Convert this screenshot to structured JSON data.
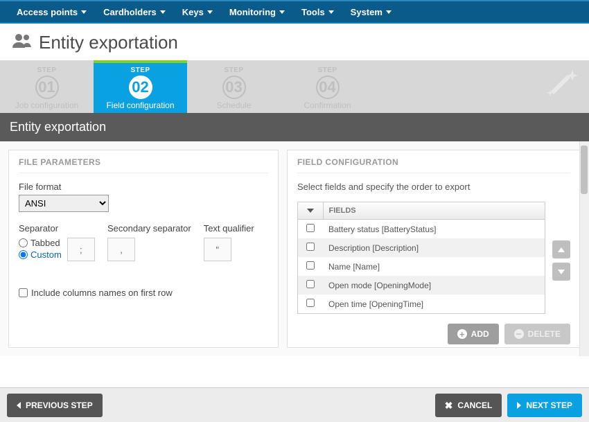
{
  "nav": {
    "items": [
      "Access points",
      "Cardholders",
      "Keys",
      "Monitoring",
      "Tools",
      "System"
    ]
  },
  "page": {
    "title": "Entity exportation"
  },
  "wizard": {
    "step_label": "STEP",
    "steps": [
      {
        "num": "01",
        "name": "Job configuration",
        "active": false
      },
      {
        "num": "02",
        "name": "Field configuration",
        "active": true
      },
      {
        "num": "03",
        "name": "Schedule",
        "active": false
      },
      {
        "num": "04",
        "name": "Confirmation",
        "active": false
      }
    ]
  },
  "section_header": "Entity exportation",
  "file_params": {
    "panel_title": "FILE PARAMETERS",
    "format_label": "File format",
    "format_value": "ANSI",
    "separator_label": "Separator",
    "sep_opt_tabbed": "Tabbed",
    "sep_opt_custom": "Custom",
    "sep_custom_value": ";",
    "secondary_label": "Secondary separator",
    "secondary_value": ",",
    "qualifier_label": "Text qualifier",
    "qualifier_value": "\"",
    "include_cols_label": "Include columns names on first row"
  },
  "field_config": {
    "panel_title": "FIELD CONFIGURATION",
    "instruction": "Select fields and specify the order to export",
    "header": "FIELDS",
    "rows": [
      "Battery status [BatteryStatus]",
      "Description [Description]",
      "Name [Name]",
      "Open mode [OpeningMode]",
      "Open time [OpeningTime]"
    ],
    "add_label": "ADD",
    "delete_label": "DELETE"
  },
  "footer": {
    "prev": "PREVIOUS STEP",
    "cancel": "CANCEL",
    "next": "NEXT STEP"
  }
}
